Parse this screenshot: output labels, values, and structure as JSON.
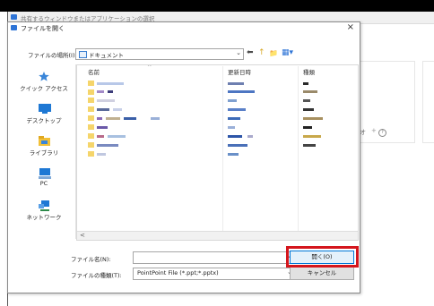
{
  "outer_window": {
    "title": "共有するウィンドウまたはアプリケーションの選択"
  },
  "background": {
    "partial_text": "オ",
    "help_glyph": "?"
  },
  "dialog": {
    "title": "ファイルを開く",
    "close_glyph": "×",
    "location_label": "ファイルの場所(I):",
    "location_value": "ドキュメント",
    "toolbar": {
      "back": "⬅",
      "up": "↑",
      "new_folder": "📁",
      "view": "▦▾"
    },
    "sidebar": {
      "items": [
        {
          "label": "クイック アクセス",
          "icon": "star-icon"
        },
        {
          "label": "デスクトップ",
          "icon": "desktop-icon"
        },
        {
          "label": "ライブラリ",
          "icon": "library-icon"
        },
        {
          "label": "PC",
          "icon": "pc-icon"
        },
        {
          "label": "ネットワーク",
          "icon": "network-icon"
        }
      ]
    },
    "columns": [
      "名前",
      "更新日時",
      "種類"
    ],
    "filename_label": "ファイル名(N):",
    "filename_value": "",
    "filetype_label": "ファイルの種類(T):",
    "filetype_value": "PointPoint File (*.ppt;*.pptx)",
    "open_button": "開く(O)",
    "cancel_button": "キャンセル"
  },
  "colors": {
    "accent": "#0078d7",
    "highlight": "#d4161d",
    "folder": "#f5d56b"
  }
}
